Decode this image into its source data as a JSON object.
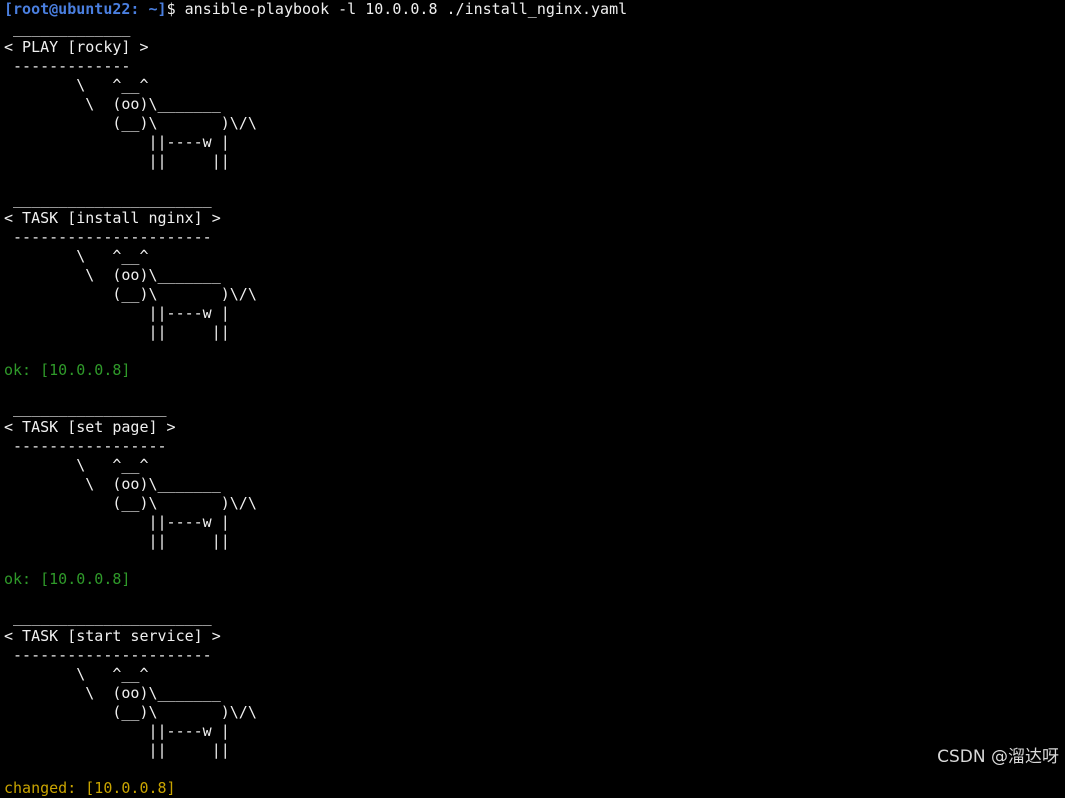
{
  "terminal": {
    "prompt": {
      "user_host": "[root@ubuntu22: ~]",
      "symbol": "$",
      "command": " ansible-playbook -l 10.0.0.8 ./install_nginx.yaml"
    },
    "play": {
      "top": " _____________",
      "title": "< PLAY [rocky] >",
      "bottom": " -------------"
    },
    "cow": [
      "        \\   ^__^",
      "         \\  (oo)\\_______",
      "            (__)\\       )\\/\\",
      "                ||----w |",
      "                ||     ||"
    ],
    "tasks": [
      {
        "top": " ______________________",
        "title": "< TASK [install nginx] >",
        "bottom": " ----------------------",
        "result": "ok: [10.0.0.8]"
      },
      {
        "top": " _________________",
        "title": "< TASK [set page] >",
        "bottom": " -----------------",
        "result": "ok: [10.0.0.8]"
      },
      {
        "top": " ______________________",
        "title": "< TASK [start service] >",
        "bottom": " ----------------------",
        "result": "changed: [10.0.0.8]"
      }
    ]
  },
  "watermark": "CSDN @溜达呀",
  "colors": {
    "background": "#000000",
    "text": "#f0f0f0",
    "prompt": "#4a7fe0",
    "ok": "#2f9a2a",
    "changed": "#c9a400"
  }
}
